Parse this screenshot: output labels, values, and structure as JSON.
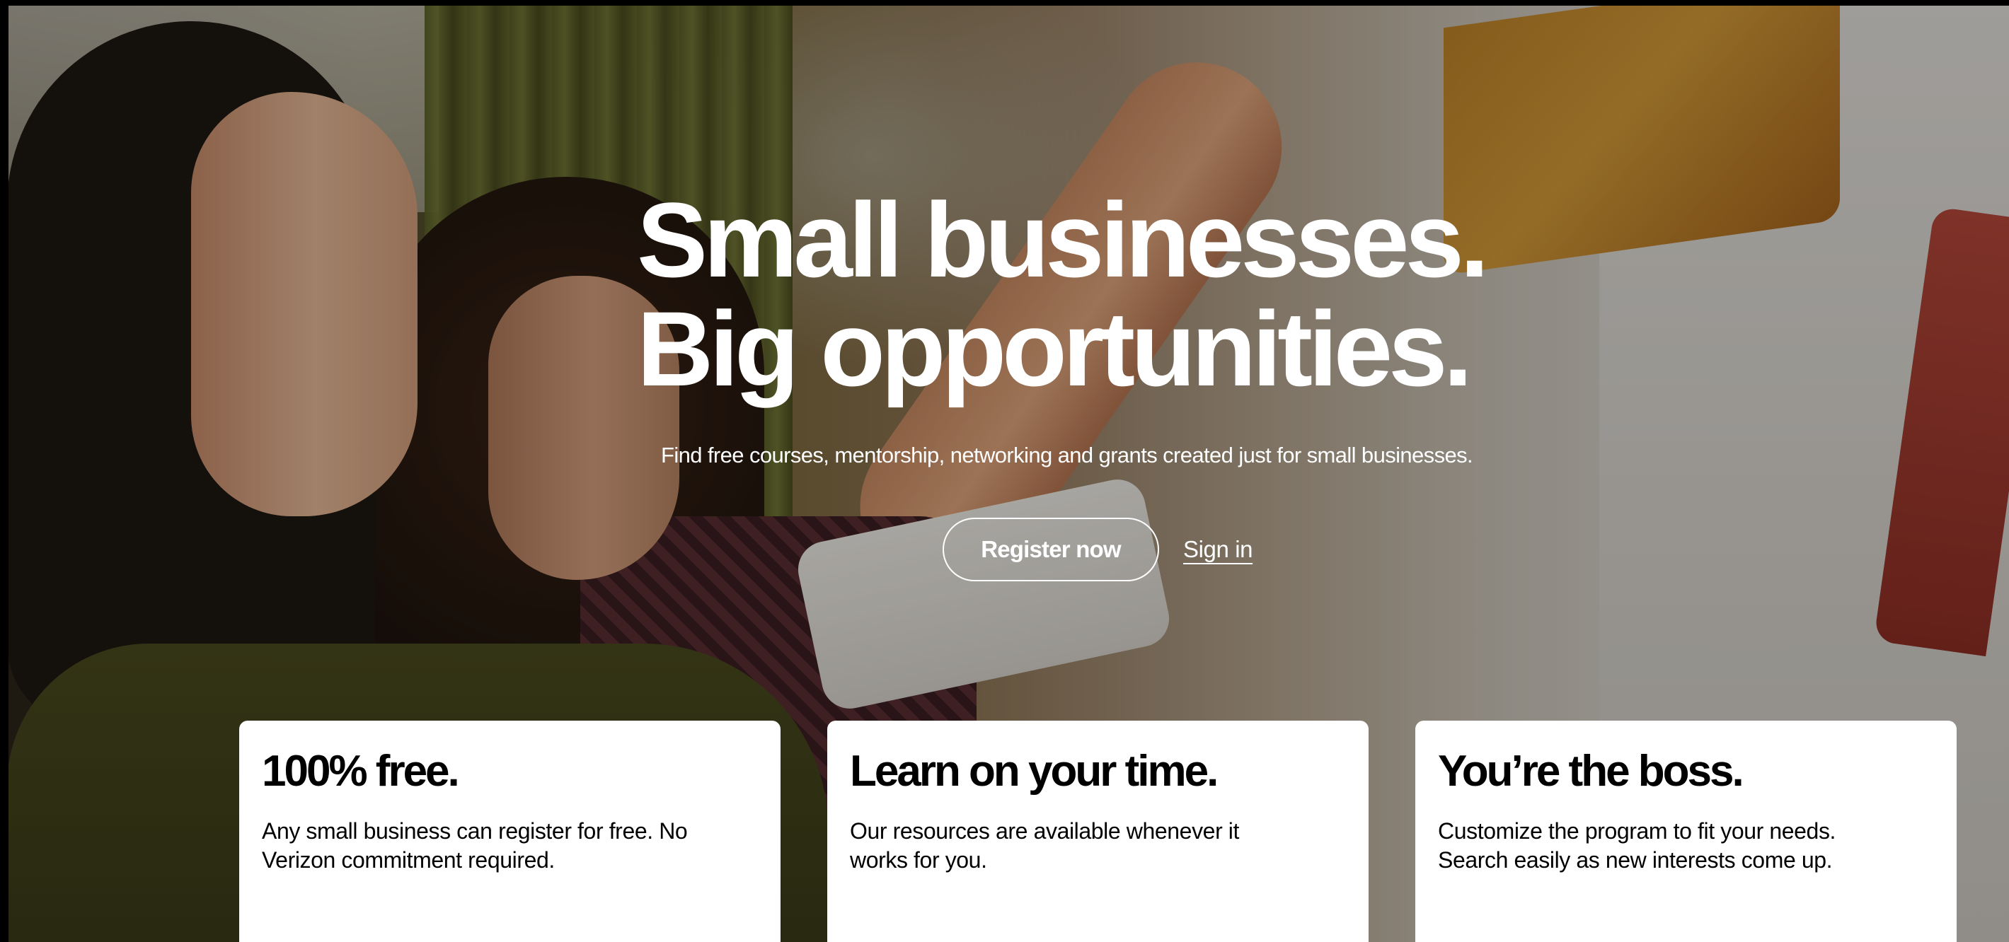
{
  "hero": {
    "headline_line1": "Small businesses.",
    "headline_line2": "Big opportunities.",
    "subhead": "Find free courses, mentorship, networking and grants created just for small businesses.",
    "register_label": "Register now",
    "signin_label": "Sign in"
  },
  "cards": [
    {
      "title": "100% free.",
      "body": "Any small business can register for free. No Verizon commitment required."
    },
    {
      "title": "Learn on your time.",
      "body": "Our resources are available whenever it works for you."
    },
    {
      "title": "You’re the boss.",
      "body": "Customize the program to fit your needs. Search easily as new interests come up."
    }
  ],
  "colors": {
    "text_on_photo": "#ffffff",
    "card_background": "#ffffff",
    "card_text": "#000000"
  }
}
